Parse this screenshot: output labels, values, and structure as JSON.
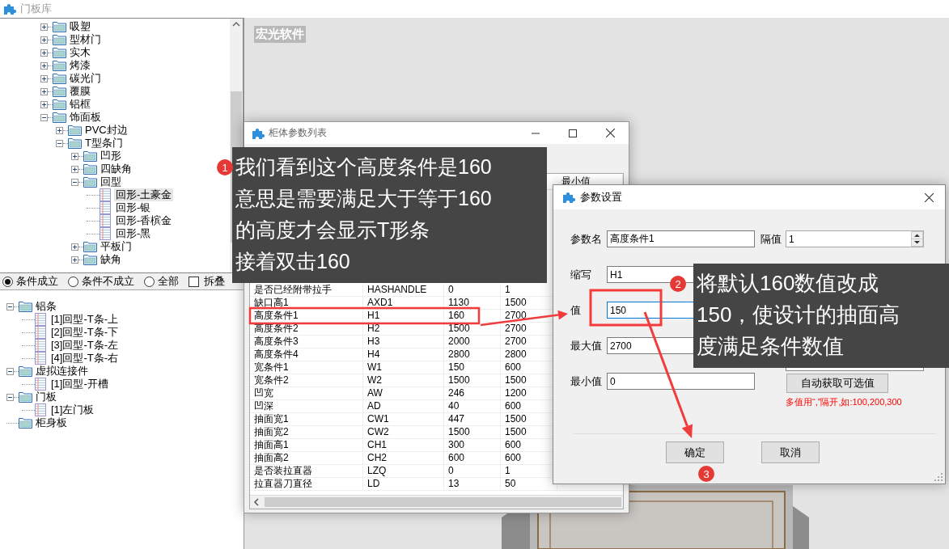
{
  "app": {
    "title": "门板库"
  },
  "library_tree": {
    "items": [
      {
        "label": "吸塑",
        "kind": "folder",
        "expanded": false,
        "selected": false
      },
      {
        "label": "型材门",
        "kind": "folder",
        "expanded": false,
        "selected": false
      },
      {
        "label": "实木",
        "kind": "folder",
        "expanded": false,
        "selected": false
      },
      {
        "label": "烤漆",
        "kind": "folder",
        "expanded": false,
        "selected": false
      },
      {
        "label": "碳光门",
        "kind": "folder",
        "expanded": false,
        "selected": false
      },
      {
        "label": "覆膜",
        "kind": "folder",
        "expanded": false,
        "selected": false
      },
      {
        "label": "铝框",
        "kind": "folder",
        "expanded": false,
        "selected": false
      },
      {
        "label": "饰面板",
        "kind": "folder",
        "expanded": true,
        "selected": false,
        "children": [
          {
            "label": "PVC封边",
            "kind": "folder",
            "expanded": false,
            "selected": false
          },
          {
            "label": "T型条门",
            "kind": "folder",
            "expanded": true,
            "selected": false,
            "children": [
              {
                "label": "凹形",
                "kind": "folder",
                "expanded": false,
                "selected": false
              },
              {
                "label": "四缺角",
                "kind": "folder",
                "expanded": false,
                "selected": false
              },
              {
                "label": "回型",
                "kind": "folder",
                "expanded": true,
                "selected": false,
                "children": [
                  {
                    "label": "回形-土豪金",
                    "kind": "leaf",
                    "selected": true
                  },
                  {
                    "label": "回形-银",
                    "kind": "leaf",
                    "selected": false
                  },
                  {
                    "label": "回形-香槟金",
                    "kind": "leaf",
                    "selected": false
                  },
                  {
                    "label": "回形-黑",
                    "kind": "leaf",
                    "selected": false
                  }
                ]
              },
              {
                "label": "平板门",
                "kind": "folder",
                "expanded": false,
                "selected": false
              },
              {
                "label": "缺角",
                "kind": "folder",
                "expanded": false,
                "selected": false
              }
            ]
          }
        ]
      }
    ]
  },
  "filters": [
    {
      "kind": "radio",
      "label": "条件成立",
      "selected": true
    },
    {
      "kind": "radio",
      "label": "条件不成立",
      "selected": false
    },
    {
      "kind": "radio",
      "label": "全部",
      "selected": false
    },
    {
      "kind": "checkbox",
      "label": "拆叠",
      "checked": false
    }
  ],
  "parts_tree": {
    "items": [
      {
        "label": "铝条",
        "kind": "folder",
        "expanded": true,
        "selected": false,
        "children": [
          {
            "label": "[1]回型-T条-上",
            "kind": "leaf",
            "selected": false
          },
          {
            "label": "[2]回型-T条-下",
            "kind": "leaf",
            "selected": false
          },
          {
            "label": "[3]回型-T条-左",
            "kind": "leaf",
            "selected": false
          },
          {
            "label": "[4]回型-T条-右",
            "kind": "leaf",
            "selected": false
          }
        ]
      },
      {
        "label": "虚拟连接件",
        "kind": "folder",
        "expanded": true,
        "selected": false,
        "children": [
          {
            "label": "[1]回型-开槽",
            "kind": "leaf",
            "selected": false
          }
        ]
      },
      {
        "label": "门板",
        "kind": "folder",
        "expanded": true,
        "selected": false,
        "children": [
          {
            "label": "[1]左门板",
            "kind": "leaf",
            "selected": false
          }
        ]
      },
      {
        "label": "柜身板",
        "kind": "folder",
        "selected": false
      }
    ]
  },
  "canvas": {
    "brand": "宏光软件"
  },
  "param_list_window": {
    "title": "柜体参数列表",
    "columns": [
      "最小值"
    ],
    "rows": [
      {
        "cells": [
          "是否已经附带拉手",
          "HASHANDLE",
          "0",
          "1"
        ]
      },
      {
        "cells": [
          "缺口高1",
          "AXD1",
          "1130",
          "1500"
        ]
      },
      {
        "cells": [
          "高度条件1",
          "H1",
          "160",
          "2700"
        ]
      },
      {
        "cells": [
          "高度条件2",
          "H2",
          "1500",
          "2700"
        ]
      },
      {
        "cells": [
          "高度条件3",
          "H3",
          "2000",
          "2700"
        ]
      },
      {
        "cells": [
          "高度条件4",
          "H4",
          "2800",
          "2800"
        ]
      },
      {
        "cells": [
          "宽条件1",
          "W1",
          "150",
          "600"
        ]
      },
      {
        "cells": [
          "宽条件2",
          "W2",
          "1500",
          "1500"
        ]
      },
      {
        "cells": [
          "凹宽",
          "AW",
          "246",
          "1200"
        ]
      },
      {
        "cells": [
          "凹深",
          "AD",
          "40",
          "600"
        ]
      },
      {
        "cells": [
          "抽面宽1",
          "CW1",
          "447",
          "1500"
        ]
      },
      {
        "cells": [
          "抽面宽2",
          "CW2",
          "1500",
          "1500"
        ]
      },
      {
        "cells": [
          "抽面高1",
          "CH1",
          "300",
          "600"
        ]
      },
      {
        "cells": [
          "抽面高2",
          "CH2",
          "600",
          "600"
        ]
      },
      {
        "cells": [
          "是否装拉直器",
          "LZQ",
          "0",
          "1"
        ]
      },
      {
        "cells": [
          "拉直器刀直径",
          "LD",
          "13",
          "50"
        ]
      }
    ]
  },
  "param_dialog": {
    "title": "参数设置",
    "fields": [
      {
        "label": "参数名",
        "value": "高度条件1",
        "focused": false
      },
      {
        "label": "缩写",
        "value": "H1",
        "focused": false
      },
      {
        "label": "值",
        "value": "150",
        "focused": true
      },
      {
        "label": "最大值",
        "value": "2700",
        "focused": false
      },
      {
        "label": "最小值",
        "value": "0",
        "focused": false
      }
    ],
    "interval": {
      "label": "隔值",
      "value": "1"
    },
    "auto_button": "自动获取可选值",
    "hint": "多值用“,”隔开,如:100,200,300",
    "buttons": [
      "确定",
      "取消"
    ]
  },
  "annotations": [
    {
      "kind": "callout",
      "number": "1",
      "lines": [
        "我们看到这个高度条件是160",
        "意思是需要满足大于等于160",
        "的高度才会显示T形条",
        "接着双击160"
      ]
    },
    {
      "kind": "callout",
      "number": "2",
      "lines": [
        "将默认160数值改成",
        "150，使设计的抽面高",
        "度满足条件数值"
      ]
    },
    {
      "kind": "badge",
      "number": "3"
    }
  ]
}
